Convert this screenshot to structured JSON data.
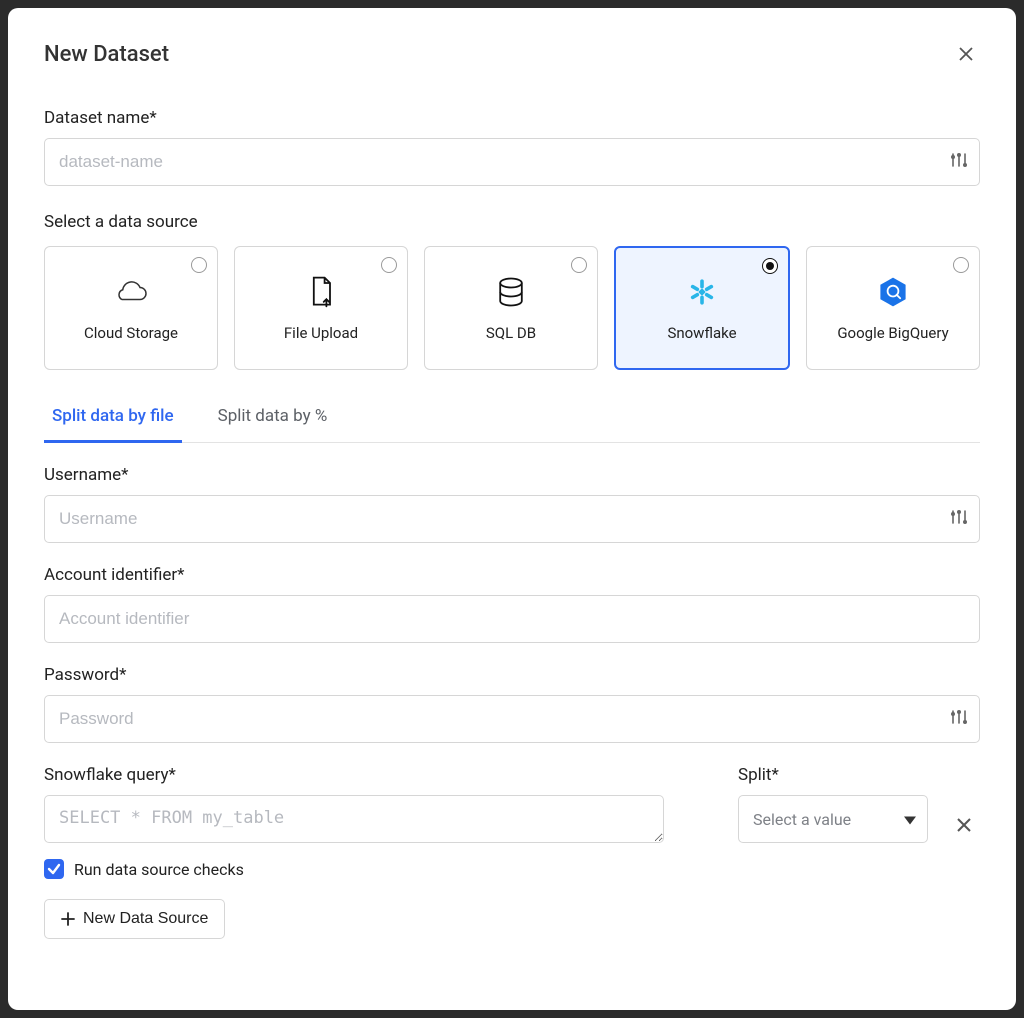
{
  "modal": {
    "title": "New Dataset"
  },
  "fields": {
    "dataset_name": {
      "label": "Dataset name*",
      "placeholder": "dataset-name"
    },
    "data_source_label": "Select a data source",
    "username": {
      "label": "Username*",
      "placeholder": "Username"
    },
    "account_id": {
      "label": "Account identifier*",
      "placeholder": "Account identifier"
    },
    "password": {
      "label": "Password*",
      "placeholder": "Password"
    },
    "query": {
      "label": "Snowflake query*",
      "placeholder": "SELECT * FROM my_table"
    },
    "split": {
      "label": "Split*",
      "placeholder": "Select a value"
    }
  },
  "data_sources": {
    "cloud_storage": "Cloud Storage",
    "file_upload": "File Upload",
    "sql_db": "SQL DB",
    "snowflake": "Snowflake",
    "bigquery": "Google BigQuery"
  },
  "tabs": {
    "by_file": "Split data by file",
    "by_percent": "Split data by %"
  },
  "checkbox": {
    "run_checks": "Run data source checks"
  },
  "buttons": {
    "new_data_source": "New Data Source"
  }
}
